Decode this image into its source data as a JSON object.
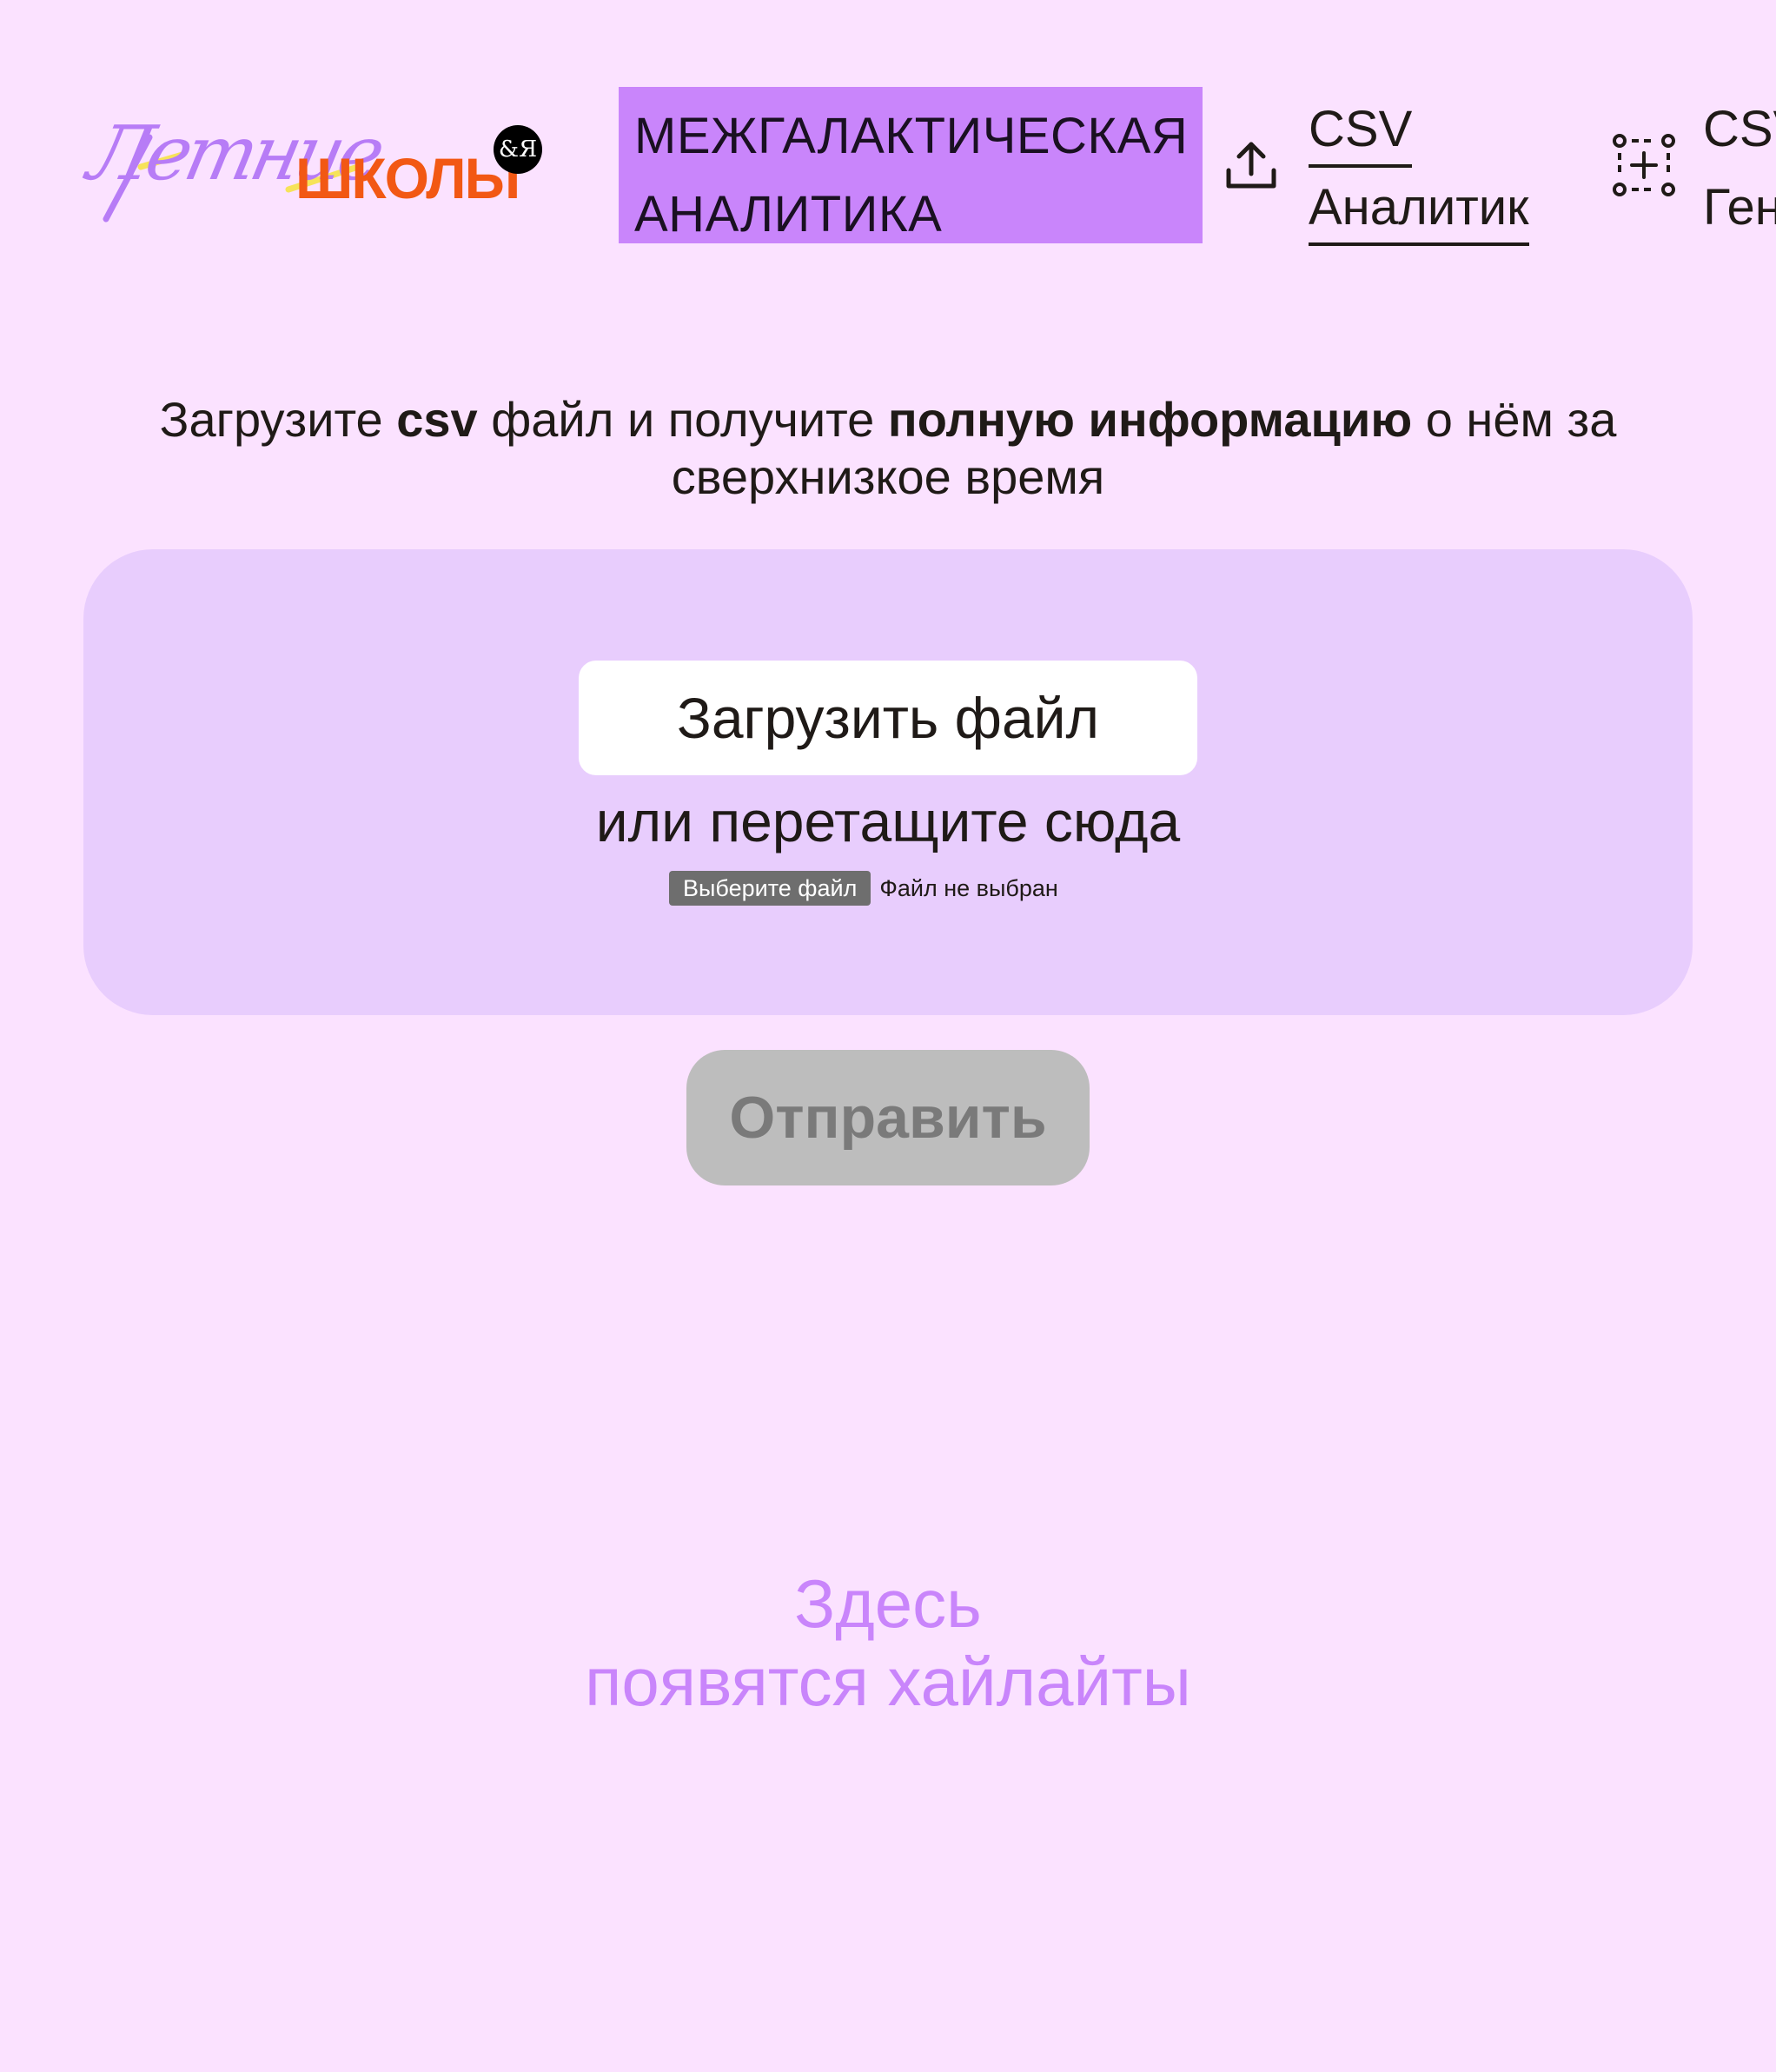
{
  "header": {
    "logo_script": "Летние",
    "logo_bold": "ШКОЛЫ",
    "logo_badge": "&Я",
    "title_line1": "МЕЖГАЛАКТИЧЕСКАЯ",
    "title_line2": "АНАЛИТИКА",
    "nav": [
      {
        "icon": "upload-icon",
        "line1": "CSV",
        "line2": "Аналитик"
      },
      {
        "icon": "add-selection-icon",
        "line1": "CSV",
        "line2": "Генератор"
      }
    ]
  },
  "intro": {
    "part1": "Загрузите ",
    "bold1": "csv",
    "part2": " файл и получите ",
    "bold2": "полную информацию",
    "part3": " о нём за сверхнизкое время"
  },
  "dropzone": {
    "upload_label": "Загрузить файл",
    "hint": "или перетащите сюда",
    "file_button": "Выберите файл",
    "file_status": "Файл не выбран"
  },
  "submit_label": "Отправить",
  "placeholder": {
    "line1": "Здесь",
    "line2": "появятся хайлайты"
  },
  "colors": {
    "background": "#fbe2ff",
    "accent": "#c985fb",
    "dropzone": "#e8cdfd",
    "logo_orange": "#f25814",
    "disabled": "#bdbdbd"
  }
}
